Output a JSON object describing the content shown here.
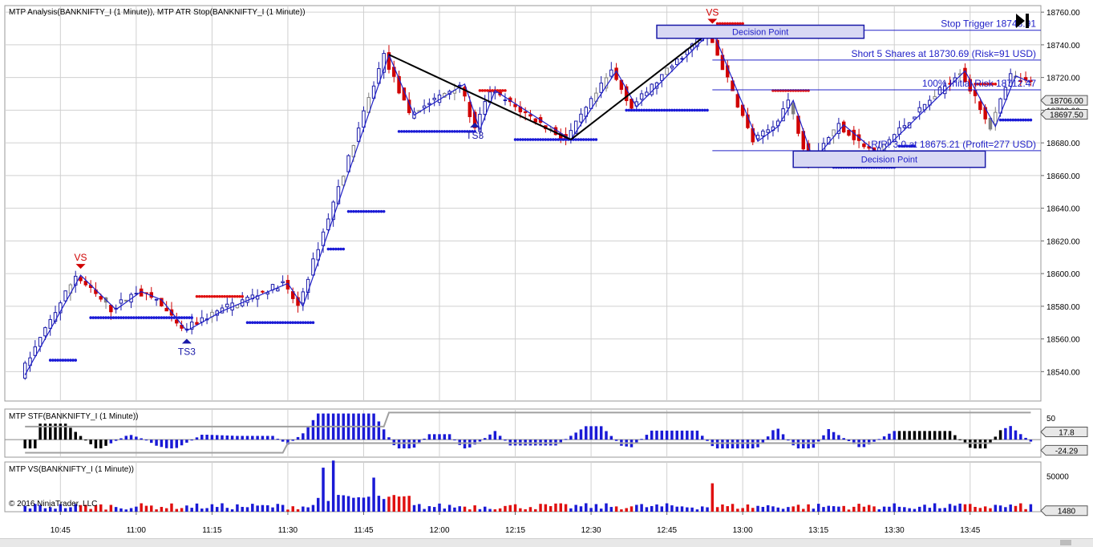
{
  "panels": {
    "price_title": "MTP Analysis(BANKNIFTY_I (1 Minute)), MTP ATR Stop(BANKNIFTY_I (1 Minute))",
    "stf_title": "MTP STF(BANKNIFTY_I (1 Minute))",
    "vs_title": "MTP VS(BANKNIFTY_I (1 Minute))",
    "copyright": "© 2016 NinjaTrader, LLC"
  },
  "colors": {
    "up_bar": "#1a1aa8",
    "down_bar": "#d00000",
    "neutral_bar": "#808080",
    "stop_dot_long": "#1a1ad6",
    "stop_dot_short": "#e01010",
    "zigzag": "#2020c8",
    "swing_line": "#000000",
    "decision_box_fill": "#d8d8f4",
    "decision_box_stroke": "#1a1aa8",
    "stf_up": "#1a1ad6",
    "stf_down": "#000000",
    "stf_band": "#a0a0a0",
    "vs_up": "#1a1ad6",
    "vs_down": "#e01010",
    "grid": "#d0d0d0",
    "price_tag_bg": "#e8e8e8"
  },
  "annotations": {
    "stop_trigger": "Stop Trigger 18748.91",
    "short_entry": "Short 5 Shares at 18730.69 (Risk=91 USD)",
    "initial_risk": "100% Initial Risk 18712.47",
    "target": "R/R: 3.0 at 18675.21 (Profit=277 USD)",
    "decision_point_1": "Decision Point",
    "decision_point_2": "Decision Point",
    "signals": [
      {
        "label": "VS",
        "time": "10:49",
        "type": "sell"
      },
      {
        "label": "TS3",
        "time": "11:10",
        "type": "buy"
      },
      {
        "label": "TS3",
        "time": "12:07",
        "type": "buy"
      },
      {
        "label": "VS",
        "time": "12:54",
        "type": "sell"
      }
    ]
  },
  "price_tags": {
    "current_1": "18706.00",
    "current_2": "18697.50"
  },
  "stf_tags": {
    "upper": "17.8",
    "lower": "-24.29"
  },
  "vs_tag": "1480",
  "chart_data": {
    "type": "candlestick",
    "x_ticks": [
      "10:45",
      "11:00",
      "11:15",
      "11:30",
      "11:45",
      "12:00",
      "12:15",
      "12:30",
      "12:45",
      "13:00",
      "13:15",
      "13:30",
      "13:45"
    ],
    "y_ticks": [
      "18540.00",
      "18560.00",
      "18580.00",
      "18600.00",
      "18620.00",
      "18640.00",
      "18660.00",
      "18680.00",
      "18700.00",
      "18720.00",
      "18740.00",
      "18760.00"
    ],
    "ylim": [
      18522,
      18764
    ],
    "zigzag_points": [
      [
        "10:38",
        18538
      ],
      [
        "10:49",
        18599
      ],
      [
        "10:56",
        18578
      ],
      [
        "11:01",
        18589
      ],
      [
        "11:05",
        18584
      ],
      [
        "11:10",
        18565
      ],
      [
        "11:17",
        18577
      ],
      [
        "11:30",
        18594
      ],
      [
        "11:33",
        18580
      ],
      [
        "11:50",
        18734
      ],
      [
        "11:55",
        18697
      ],
      [
        "12:05",
        18716
      ],
      [
        "12:08",
        18688
      ],
      [
        "12:11",
        18712
      ],
      [
        "12:26",
        18682
      ],
      [
        "12:35",
        18724
      ],
      [
        "12:39",
        18702
      ],
      [
        "12:54",
        18749
      ],
      [
        "13:03",
        18681
      ],
      [
        "13:07",
        18690
      ],
      [
        "13:10",
        18706
      ],
      [
        "13:14",
        18669
      ],
      [
        "13:20",
        18691
      ],
      [
        "13:27",
        18673
      ],
      [
        "13:44",
        18724
      ],
      [
        "13:50",
        18690
      ],
      [
        "13:54",
        18721
      ],
      [
        "13:57",
        18717
      ]
    ],
    "swing_lines": [
      [
        [
          "11:50",
          18734
        ],
        [
          "12:26",
          18682
        ]
      ],
      [
        [
          "12:26",
          18682
        ],
        [
          "12:54",
          18749
        ]
      ]
    ],
    "levels": {
      "stop_trigger": 18748.91,
      "short_entry": 18730.69,
      "initial_risk": 18712.47,
      "target": 18675.21
    },
    "decision_boxes": [
      {
        "t_start": "12:43",
        "t_end": "13:24",
        "low": 18744,
        "high": 18752
      },
      {
        "t_start": "13:10",
        "t_end": "13:48",
        "low": 18665,
        "high": 18675
      }
    ],
    "atr_stop_segments": [
      {
        "side": "long",
        "t_start": "10:43",
        "t_end": "10:48",
        "value": 18547
      },
      {
        "side": "long",
        "t_start": "10:51",
        "t_end": "11:11",
        "value": 18573
      },
      {
        "side": "short",
        "t_start": "11:12",
        "t_end": "11:21",
        "value": 18586
      },
      {
        "side": "long",
        "t_start": "11:22",
        "t_end": "11:35",
        "value": 18570
      },
      {
        "side": "long",
        "t_start": "11:38",
        "t_end": "11:41",
        "value": 18615
      },
      {
        "side": "long",
        "t_start": "11:42",
        "t_end": "11:49",
        "value": 18638
      },
      {
        "side": "long",
        "t_start": "11:52",
        "t_end": "12:07",
        "value": 18687
      },
      {
        "side": "short",
        "t_start": "12:08",
        "t_end": "12:13",
        "value": 18712
      },
      {
        "side": "long",
        "t_start": "12:15",
        "t_end": "12:31",
        "value": 18682
      },
      {
        "side": "long",
        "t_start": "12:37",
        "t_end": "12:53",
        "value": 18700
      },
      {
        "side": "short",
        "t_start": "12:55",
        "t_end": "13:00",
        "value": 18753
      },
      {
        "side": "short",
        "t_start": "13:06",
        "t_end": "13:13",
        "value": 18712
      },
      {
        "side": "long",
        "t_start": "13:18",
        "t_end": "13:30",
        "value": 18665
      },
      {
        "side": "long",
        "t_start": "13:31",
        "t_end": "13:34",
        "value": 18678
      },
      {
        "side": "short",
        "t_start": "13:46",
        "t_end": "13:50",
        "value": 18716
      },
      {
        "side": "long",
        "t_start": "13:51",
        "t_end": "13:57",
        "value": 18694
      }
    ],
    "stf_axis": {
      "ticks": [
        "50"
      ],
      "ylim": [
        -40,
        70
      ]
    },
    "vs_axis": {
      "ticks": [
        "50000"
      ],
      "ylim": [
        0,
        70000
      ]
    }
  }
}
